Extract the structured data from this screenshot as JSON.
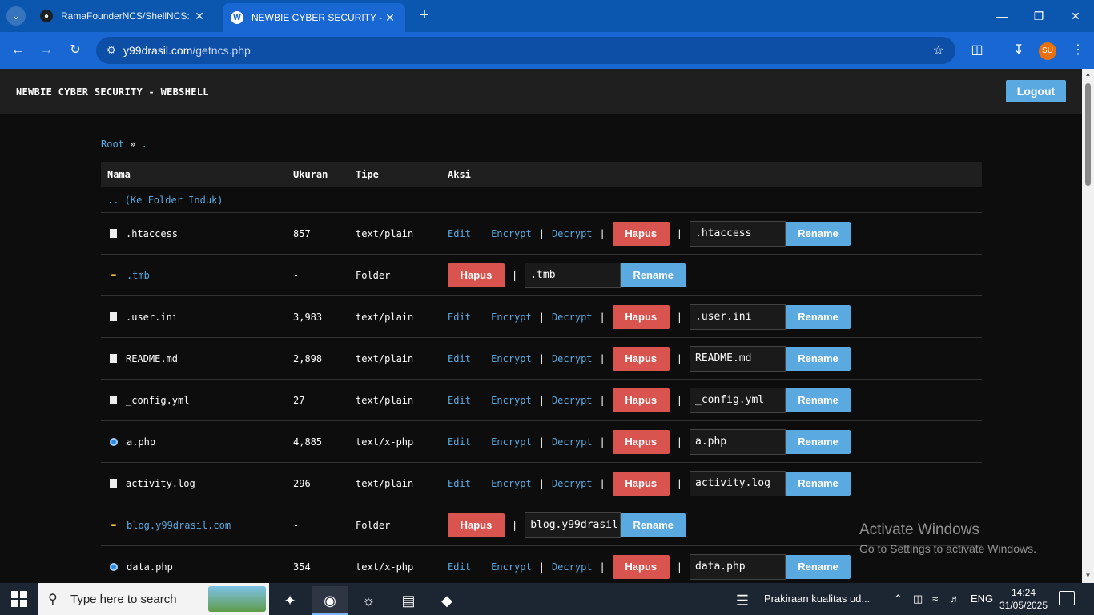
{
  "browser": {
    "tabs": [
      {
        "title": "RamaFounderNCS/ShellNCS: W",
        "active": false,
        "icon": "github-icon"
      },
      {
        "title": "NEWBIE CYBER SECURITY - SHE",
        "active": true,
        "icon": "wordpress-icon"
      }
    ],
    "url_host": "y99drasil.com",
    "url_path": "/getncs.php",
    "profile_initials": "SU"
  },
  "page": {
    "site_title": "NEWBIE CYBER SECURITY - WEBSHELL",
    "logout_label": "Logout",
    "breadcrumb": {
      "root": "Root",
      "separator": "»",
      "current": "."
    },
    "table": {
      "headers": {
        "name": "Nama",
        "size": "Ukuran",
        "type": "Tipe",
        "actions": "Aksi"
      },
      "parent_link": ".. (Ke Folder Induk)",
      "action_labels": {
        "edit": "Edit",
        "encrypt": "Encrypt",
        "decrypt": "Decrypt",
        "delete": "Hapus",
        "rename": "Rename",
        "sep": "|"
      },
      "rows": [
        {
          "name": ".htaccess",
          "size": "857",
          "type": "text/plain",
          "kind": "file"
        },
        {
          "name": ".tmb",
          "size": "-",
          "type": "Folder",
          "kind": "folder"
        },
        {
          "name": ".user.ini",
          "size": "3,983",
          "type": "text/plain",
          "kind": "file"
        },
        {
          "name": "README.md",
          "size": "2,898",
          "type": "text/plain",
          "kind": "file"
        },
        {
          "name": "_config.yml",
          "size": "27",
          "type": "text/plain",
          "kind": "file"
        },
        {
          "name": "a.php",
          "size": "4,885",
          "type": "text/x-php",
          "kind": "php"
        },
        {
          "name": "activity.log",
          "size": "296",
          "type": "text/plain",
          "kind": "file"
        },
        {
          "name": "blog.y99drasil.com",
          "size": "-",
          "type": "Folder",
          "kind": "folder"
        },
        {
          "name": "data.php",
          "size": "354",
          "type": "text/x-php",
          "kind": "php"
        }
      ]
    }
  },
  "watermark": {
    "title": "Activate Windows",
    "subtitle": "Go to Settings to activate Windows."
  },
  "taskbar": {
    "search_placeholder": "Type here to search",
    "weather": "Prakiraan kualitas ud...",
    "language": "ENG",
    "time": "14:24",
    "date": "31/05/2025"
  },
  "colors": {
    "link": "#5aa9e0",
    "delete": "#d9534f",
    "rename": "#5aa9e0",
    "header_bg": "#1f1f1f",
    "chrome_blue": "#1967d2"
  }
}
